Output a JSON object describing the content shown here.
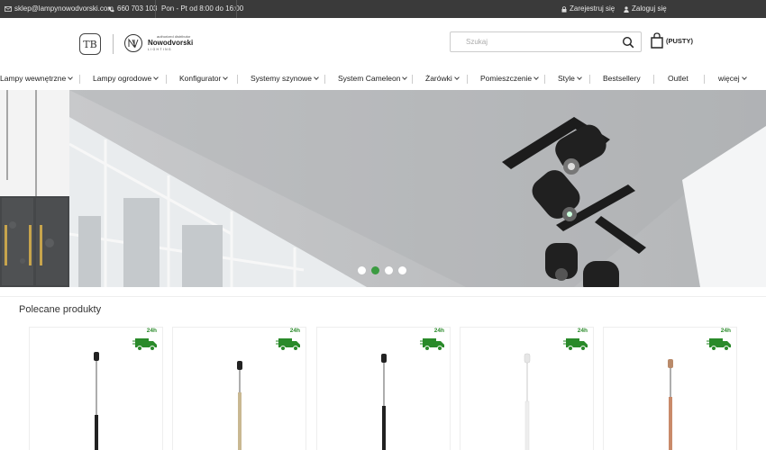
{
  "topbar": {
    "email": "sklep@lampynowodvorski.com",
    "phone": "660 703 103",
    "hours": "Pon - Pt od 8:00 do 16:00",
    "register": "Zarejestruj się",
    "login": "Zaloguj się"
  },
  "header": {
    "logo_letters": "TB",
    "partner_small": "authorized distributor",
    "partner_name": "Nowodvorski",
    "partner_sub": "LIGHTING",
    "search_placeholder": "Szukaj",
    "cart_label": "(PUSTY)"
  },
  "nav": {
    "items": [
      {
        "label": "Lampy wewnętrzne",
        "dropdown": true
      },
      {
        "label": "Lampy ogrodowe",
        "dropdown": true
      },
      {
        "label": "Konfigurator",
        "dropdown": true
      },
      {
        "label": "Systemy szynowe",
        "dropdown": true
      },
      {
        "label": "System Cameleon",
        "dropdown": true
      },
      {
        "label": "Żarówki",
        "dropdown": true
      },
      {
        "label": "Pomieszczenie",
        "dropdown": true
      },
      {
        "label": "Style",
        "dropdown": true
      },
      {
        "label": "Bestsellery",
        "dropdown": false
      },
      {
        "label": "Outlet",
        "dropdown": false
      },
      {
        "label": "więcej",
        "dropdown": true
      }
    ]
  },
  "hero": {
    "slide_count": 4,
    "active_slide": 2
  },
  "featured": {
    "title": "Polecane produkty",
    "products": [
      {
        "badge": "24h",
        "lamp_color": "#222222"
      },
      {
        "badge": "24h",
        "lamp_color": "#c9b892"
      },
      {
        "badge": "24h",
        "lamp_color": "#222222"
      },
      {
        "badge": "24h",
        "lamp_color": "#eeeeee"
      },
      {
        "badge": "24h",
        "lamp_color": "#c98a6a"
      }
    ]
  },
  "colors": {
    "topbar_bg": "#3a3a3a",
    "accent_green": "#3b9b41",
    "badge_green": "#2a8a2a"
  }
}
